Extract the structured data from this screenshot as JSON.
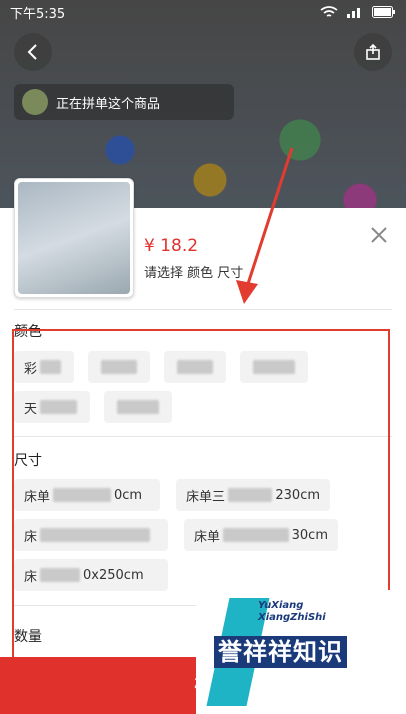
{
  "status_bar": {
    "time": "下午5:35"
  },
  "group_banner": {
    "text": "正在拼单这个商品"
  },
  "product": {
    "price": "¥ 18.2",
    "select_hint": "请选择 颜色 尺寸"
  },
  "sections": {
    "color_title": "颜色",
    "size_title": "尺寸",
    "quantity_title": "数量"
  },
  "color_options": [
    "彩",
    "",
    "",
    "",
    "天",
    ""
  ],
  "size_options": [
    "床单",
    "0cm",
    "床单三",
    "230cm",
    "床",
    "床单",
    "30cm",
    "床",
    "0x250cm"
  ],
  "confirm": {
    "label": "确"
  },
  "watermark": {
    "en_line1": "YuXiang",
    "en_line2": "XiangZhiShi",
    "cn": "誉祥祥知识"
  },
  "colors": {
    "accent": "#e0312c",
    "annotation": "#e23b2f"
  }
}
